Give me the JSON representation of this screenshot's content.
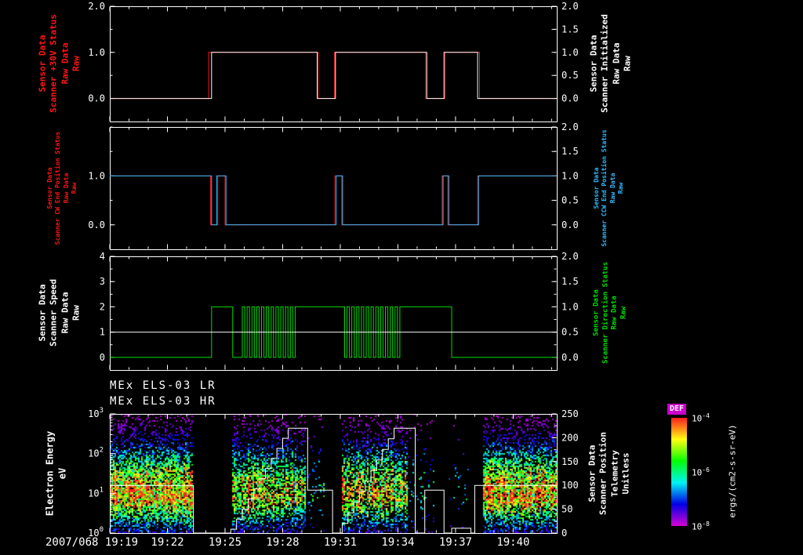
{
  "chart_data": {
    "type": "multi-panel timeseries + spectrogram",
    "titles": [
      "MEx ELS-03 LR",
      "MEx ELS-03 HR"
    ],
    "time": {
      "date": "2007/068",
      "tick_labels": [
        "19:19",
        "19:22",
        "19:25",
        "19:28",
        "19:31",
        "19:34",
        "19:37",
        "19:40"
      ],
      "tick_minutes": [
        0,
        3,
        6,
        9,
        12,
        15,
        18,
        21
      ],
      "minutes_span": 23.27,
      "minor_step_min": 1
    },
    "colors": {
      "background": "#000000",
      "axis": "#ffffff",
      "red": "#ff1515",
      "cyan": "#33bbff",
      "green": "#00dd00",
      "white": "#ffffff"
    },
    "panels": [
      {
        "name": "scanner-status-panel",
        "yrange": [
          -0.5,
          2.0
        ],
        "minor_step": 0.5,
        "left_label": {
          "lines": [
            "Sensor Data",
            "Scanner +30V Status",
            "Raw Data",
            "Raw"
          ],
          "color": "#ff1515",
          "size": 11
        },
        "right_label": {
          "lines": [
            "Sensor Data",
            "Scanner Initialized",
            "Raw Data",
            "Raw"
          ],
          "color": "#ffffff",
          "size": 11
        },
        "left_ticks": [
          {
            "v": 2,
            "label": "2.0"
          },
          {
            "v": 1,
            "label": "1.0"
          },
          {
            "v": 0,
            "label": "0.0"
          }
        ],
        "right_ticks": [
          {
            "v": 2,
            "label": "2.0"
          },
          {
            "v": 1.5,
            "label": "1.5"
          },
          {
            "v": 1,
            "label": "1.0"
          },
          {
            "v": 0.5,
            "label": "0.5"
          },
          {
            "v": 0,
            "label": "0.0"
          }
        ],
        "series": [
          {
            "name": "scanner-plus30v-status-raw",
            "color": "#ff1515",
            "segments": [
              {
                "t0": 0,
                "t1": 5.15,
                "v": 0
              },
              {
                "t0": 5.15,
                "t1": 10.85,
                "v": 1
              },
              {
                "t0": 10.85,
                "t1": 11.7,
                "v": 0
              },
              {
                "t0": 11.7,
                "t1": 16.45,
                "v": 1
              },
              {
                "t0": 16.45,
                "t1": 17.45,
                "v": 0
              },
              {
                "t0": 17.45,
                "t1": 19.25,
                "v": 1
              },
              {
                "t0": 19.25,
                "t1": 23.27,
                "v": 0
              }
            ]
          },
          {
            "name": "scanner-initialized-raw",
            "color": "#ffffff",
            "segments": [
              {
                "t0": 0,
                "t1": 5.3,
                "v": 0
              },
              {
                "t0": 5.3,
                "t1": 10.8,
                "v": 1
              },
              {
                "t0": 10.8,
                "t1": 11.75,
                "v": 0
              },
              {
                "t0": 11.75,
                "t1": 16.5,
                "v": 1
              },
              {
                "t0": 16.5,
                "t1": 17.4,
                "v": 0
              },
              {
                "t0": 17.4,
                "t1": 19.15,
                "v": 1
              },
              {
                "t0": 19.15,
                "t1": 23.27,
                "v": 0
              }
            ]
          }
        ]
      },
      {
        "name": "end-position-status-panel",
        "yrange": [
          -0.5,
          2.0
        ],
        "minor_step": 0.5,
        "left_label": {
          "lines": [
            "Sensor Data",
            "Scanner CW End Position Status",
            "Raw Data",
            "Raw"
          ],
          "color": "#ff1515",
          "size": 8
        },
        "right_label": {
          "lines": [
            "Sensor Data",
            "Scanner CCW End Position Status",
            "Raw Data",
            "Raw"
          ],
          "color": "#33bbff",
          "size": 8
        },
        "left_ticks": [
          {
            "v": 1,
            "label": "1.0"
          },
          {
            "v": 0,
            "label": "0.0"
          }
        ],
        "right_ticks": [
          {
            "v": 2,
            "label": "2.0"
          },
          {
            "v": 1.5,
            "label": "1.5"
          },
          {
            "v": 1,
            "label": "1.0"
          },
          {
            "v": 0.5,
            "label": "0.5"
          },
          {
            "v": 0,
            "label": "0.0"
          }
        ],
        "series": [
          {
            "name": "scanner-cw-end-position-status-raw",
            "color": "#ff1515",
            "segments": [
              {
                "t0": 0,
                "t1": 5.25,
                "v": 1
              },
              {
                "t0": 5.25,
                "t1": 5.62,
                "v": 0
              },
              {
                "t0": 5.62,
                "t1": 6.0,
                "v": 1
              },
              {
                "t0": 6.0,
                "t1": 11.72,
                "v": 0
              },
              {
                "t0": 11.72,
                "t1": 12.08,
                "v": 1
              },
              {
                "t0": 12.08,
                "t1": 17.3,
                "v": 0
              },
              {
                "t0": 17.3,
                "t1": 17.6,
                "v": 1
              },
              {
                "t0": 17.6,
                "t1": 19.15,
                "v": 0
              },
              {
                "t0": 19.15,
                "t1": 23.27,
                "v": 1
              }
            ]
          },
          {
            "name": "scanner-ccw-end-position-status-raw",
            "color": "#33bbff",
            "segments": [
              {
                "t0": 0,
                "t1": 5.3,
                "v": 1
              },
              {
                "t0": 5.3,
                "t1": 5.57,
                "v": 0
              },
              {
                "t0": 5.57,
                "t1": 6.05,
                "v": 1
              },
              {
                "t0": 6.05,
                "t1": 11.78,
                "v": 0
              },
              {
                "t0": 11.78,
                "t1": 12.12,
                "v": 1
              },
              {
                "t0": 12.12,
                "t1": 17.35,
                "v": 0
              },
              {
                "t0": 17.35,
                "t1": 17.65,
                "v": 1
              },
              {
                "t0": 17.65,
                "t1": 19.2,
                "v": 0
              },
              {
                "t0": 19.2,
                "t1": 23.27,
                "v": 1
              }
            ]
          }
        ]
      },
      {
        "name": "scanner-speed-panel",
        "yrange": [
          -0.5,
          4.0
        ],
        "minor_step": 0.5,
        "left_label": {
          "lines": [
            "Sensor Data",
            "Scanner Speed",
            "Raw Data",
            "Raw"
          ],
          "color": "#ffffff",
          "size": 11
        },
        "right_label": {
          "lines": [
            "Sensor Data",
            "Scanner Direction Status",
            "Raw Data",
            "Raw"
          ],
          "color": "#00dd00",
          "size": 9
        },
        "left_ticks": [
          {
            "v": 4,
            "label": "4"
          },
          {
            "v": 3,
            "label": "3"
          },
          {
            "v": 2,
            "label": "2"
          },
          {
            "v": 1,
            "label": "1"
          },
          {
            "v": 0,
            "label": "0"
          }
        ],
        "right_ticks": [
          {
            "v": 4,
            "label": "2.0"
          },
          {
            "v": 3,
            "label": "1.5"
          },
          {
            "v": 2,
            "label": "1.0"
          },
          {
            "v": 1,
            "label": "0.5"
          },
          {
            "v": 0,
            "label": "0.0"
          }
        ],
        "series": [
          {
            "name": "scanner-direction-status-raw",
            "color": "#00dd00",
            "segments": [
              {
                "t0": 0,
                "t1": 5.3,
                "v": 0
              },
              {
                "t0": 5.3,
                "t1": 6.4,
                "v": 2
              },
              {
                "t0": 6.4,
                "t1": 6.9,
                "v": 0
              },
              {
                "t0": 6.9,
                "t1": 9.7,
                "osc": {
                  "period": 0.25,
                  "lo": 0,
                  "hi": 2
                }
              },
              {
                "t0": 9.7,
                "t1": 12.1,
                "v": 2
              },
              {
                "t0": 12.1,
                "t1": 15.2,
                "osc": {
                  "period": 0.25,
                  "lo": 0,
                  "hi": 2
                }
              },
              {
                "t0": 15.2,
                "t1": 17.8,
                "v": 2
              },
              {
                "t0": 17.8,
                "t1": 23.27,
                "v": 0
              }
            ]
          },
          {
            "name": "scanner-speed-raw",
            "color": "#ffffff",
            "segments": [
              {
                "t0": 0,
                "t1": 23.27,
                "v": 1
              }
            ]
          }
        ]
      },
      {
        "name": "spectrogram-panel",
        "ylog": true,
        "energy_range_ev": [
          1,
          1000
        ],
        "left_label": {
          "lines": [
            "Electron Energy",
            "eV"
          ],
          "color": "#ffffff",
          "size": 12
        },
        "right_label": {
          "lines": [
            "Sensor Data",
            "Scanner Position",
            "Telemetry",
            "Unitless"
          ],
          "color": "#ffffff",
          "size": 11
        },
        "left_ticks": [
          {
            "base": "10",
            "exp": "3",
            "v": 1000
          },
          {
            "base": "10",
            "exp": "2",
            "v": 100
          },
          {
            "base": "10",
            "exp": "1",
            "v": 10
          },
          {
            "base": "10",
            "exp": "0",
            "v": 1
          }
        ],
        "right_range": [
          0,
          250
        ],
        "right_ticks": [
          {
            "v": 250,
            "label": "250"
          },
          {
            "v": 200,
            "label": "200"
          },
          {
            "v": 150,
            "label": "150"
          },
          {
            "v": 100,
            "label": "100"
          },
          {
            "v": 50,
            "label": "50"
          },
          {
            "v": 0,
            "label": "0"
          }
        ],
        "overlay_series": {
          "name": "scanner-position-telemetry",
          "color": "#ffffff",
          "segments": [
            {
              "t0": 0,
              "t1": 4.35,
              "v": 100
            },
            {
              "t0": 4.35,
              "t1": 6.3,
              "v": 0
            },
            {
              "t0": 6.3,
              "t1": 9.6,
              "ramp": {
                "v0": 8,
                "v1": 220,
                "steps": 11
              }
            },
            {
              "t0": 9.6,
              "t1": 10.3,
              "v": 220
            },
            {
              "t0": 10.3,
              "t1": 11.6,
              "v": 90
            },
            {
              "t0": 11.6,
              "t1": 12.1,
              "v": 0
            },
            {
              "t0": 12.1,
              "t1": 15.1,
              "ramp": {
                "v0": 20,
                "v1": 220,
                "steps": 10
              }
            },
            {
              "t0": 15.1,
              "t1": 15.9,
              "v": 220
            },
            {
              "t0": 15.9,
              "t1": 16.4,
              "v": 0
            },
            {
              "t0": 16.4,
              "t1": 17.4,
              "v": 90
            },
            {
              "t0": 17.4,
              "t1": 17.8,
              "v": 0
            },
            {
              "t0": 17.8,
              "t1": 18.8,
              "v": 10
            },
            {
              "t0": 18.8,
              "t1": 19.0,
              "v": 0
            },
            {
              "t0": 19.0,
              "t1": 23.27,
              "v": 100
            }
          ]
        }
      }
    ],
    "spectrogram": {
      "seed": 20070680,
      "peak_log": 0.95,
      "sigma": 0.8,
      "stripe_period_min": 0.25,
      "value_range": [
        "1e-8",
        "1e-4"
      ],
      "bursts": [
        {
          "t0": 0.0,
          "t1": 4.35,
          "density": 0.88,
          "stripes": false,
          "amp": 1.0
        },
        {
          "t0": 6.35,
          "t1": 10.2,
          "density": 0.8,
          "stripes": true,
          "amp": 1.0
        },
        {
          "t0": 12.05,
          "t1": 15.5,
          "density": 0.8,
          "stripes": true,
          "amp": 1.0
        },
        {
          "t0": 19.45,
          "t1": 23.27,
          "density": 0.85,
          "stripes": false,
          "amp": 0.95
        },
        {
          "t0": 10.25,
          "t1": 11.15,
          "density": 0.1,
          "stripes": false,
          "amp": 0.5
        },
        {
          "t0": 15.55,
          "t1": 16.9,
          "density": 0.09,
          "stripes": false,
          "amp": 0.5
        },
        {
          "t0": 17.6,
          "t1": 18.9,
          "density": 0.04,
          "stripes": false,
          "amp": 0.4
        }
      ]
    },
    "colorbar": {
      "title": "DEF",
      "title_color": "#ffffff",
      "title_bg": "#cc00cc",
      "unit": "ergs/(cm2-s-sr-eV)",
      "ticks": [
        {
          "base": "10",
          "exp": "-4",
          "frac": 0
        },
        {
          "base": "10",
          "exp": "-6",
          "frac": 0.5
        },
        {
          "base": "10",
          "exp": "-8",
          "frac": 1
        }
      ]
    }
  }
}
